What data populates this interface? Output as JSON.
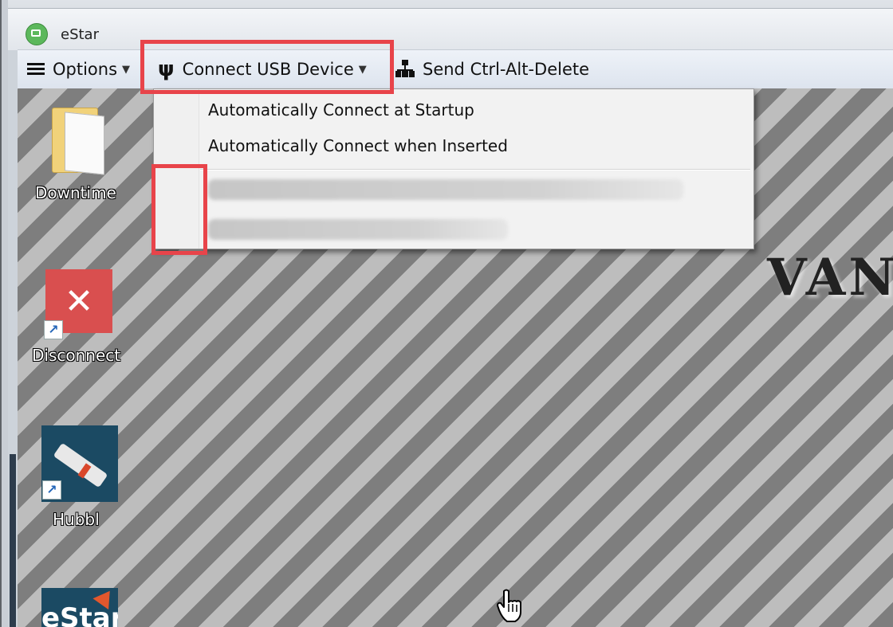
{
  "window": {
    "title": "eStar",
    "app_icon": "monitor-icon"
  },
  "toolbar": {
    "options_label": "Options",
    "connect_usb_label": "Connect USB Device",
    "send_cad_label": "Send Ctrl-Alt-Delete"
  },
  "usb_menu": {
    "items": [
      {
        "label": "Automatically Connect at Startup"
      },
      {
        "label": "Automatically Connect when Inserted"
      }
    ],
    "redacted_items": 2
  },
  "desktop": {
    "brand_text": "VAN",
    "icons": [
      {
        "label": "Downtime",
        "icon": "folder-icon"
      },
      {
        "label": "Disconnect",
        "icon": "disconnect-icon"
      },
      {
        "label": "Hubbl",
        "icon": "hubbl-icon"
      },
      {
        "label": "eStar",
        "icon": "estar-icon"
      }
    ]
  },
  "colors": {
    "highlight": "#e8444a",
    "toolbar_bg": "#e6ecf4",
    "menu_bg": "#f2f2f2"
  }
}
